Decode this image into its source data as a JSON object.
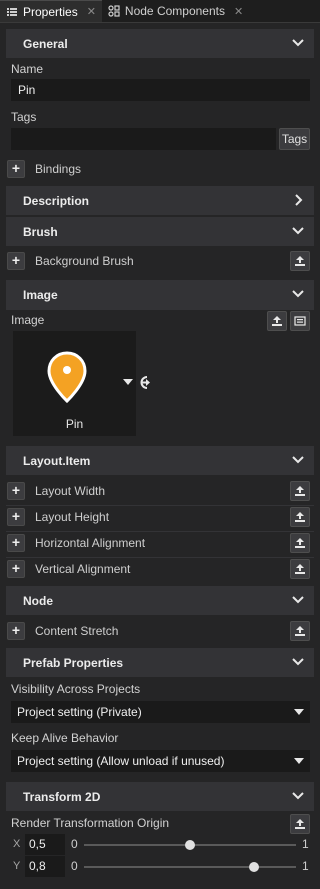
{
  "tabs": [
    {
      "label": "Properties",
      "icon": "list-icon",
      "active": true
    },
    {
      "label": "Node Components",
      "icon": "components-icon",
      "active": false
    }
  ],
  "sections": {
    "general": "General",
    "description": "Description",
    "brush": "Brush",
    "image": "Image",
    "layout_item": "Layout.Item",
    "node": "Node",
    "prefab": "Prefab Properties",
    "transform2d": "Transform 2D"
  },
  "general": {
    "name_label": "Name",
    "name_value": "Pin",
    "tags_label": "Tags",
    "tags_value": "",
    "tags_button": "Tags",
    "bindings": "Bindings"
  },
  "brush": {
    "background_brush": "Background Brush"
  },
  "image": {
    "label": "Image",
    "asset_name": "Pin",
    "accent": "#f4a223"
  },
  "layout_item": {
    "rows": [
      "Layout Width",
      "Layout Height",
      "Horizontal Alignment",
      "Vertical Alignment"
    ]
  },
  "node": {
    "content_stretch": "Content Stretch"
  },
  "prefab": {
    "visibility_label": "Visibility Across Projects",
    "visibility_value": "Project setting (Private)",
    "keep_alive_label": "Keep Alive Behavior",
    "keep_alive_value": "Project setting (Allow unload if unused)"
  },
  "transform2d": {
    "origin_label": "Render Transformation Origin",
    "x_axis": "X",
    "y_axis": "Y",
    "x_value": "0,5",
    "y_value": "0,8",
    "x_fraction": 0.5,
    "y_fraction": 0.8,
    "min": "0",
    "max": "1"
  }
}
